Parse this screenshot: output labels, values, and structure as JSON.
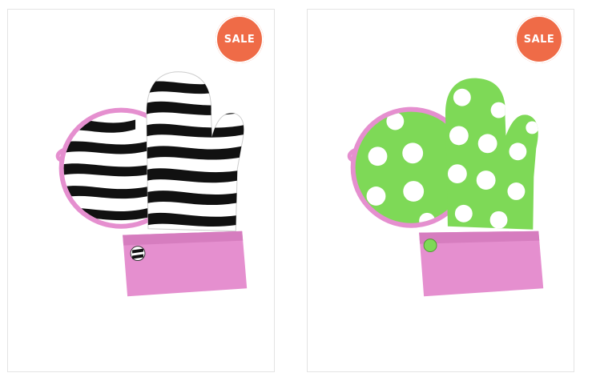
{
  "products": [
    {
      "badge": "SALE",
      "pattern": "zebra",
      "image_name": "zebra-oven-mitt-set-image"
    },
    {
      "badge": "SALE",
      "pattern": "polka-dot",
      "image_name": "polka-dot-oven-mitt-set-image"
    }
  ],
  "colors": {
    "sale_badge": "#ef6b47",
    "cuff_pink": "#e58fcf",
    "mitt_green": "#7ed957",
    "dot_white": "#ffffff",
    "zebra_black": "#111111"
  }
}
